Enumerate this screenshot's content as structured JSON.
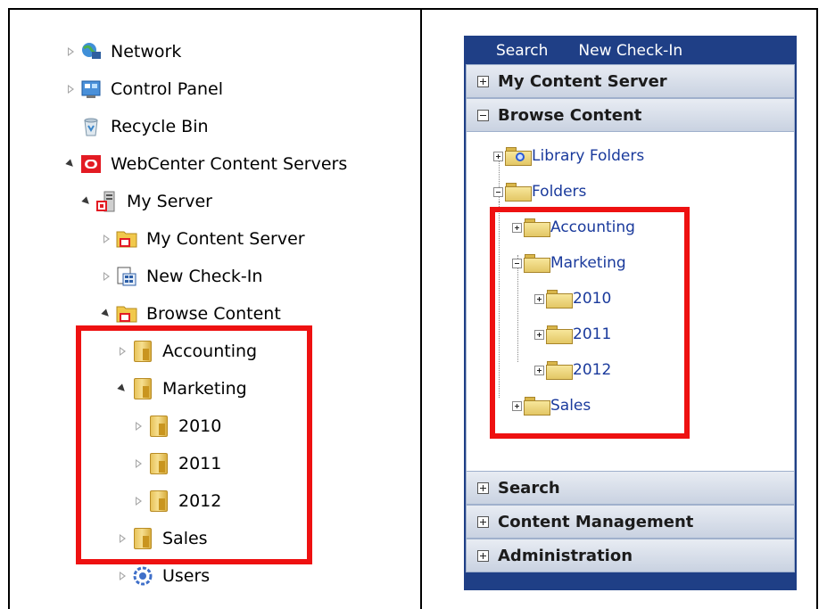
{
  "explorer": {
    "items": [
      {
        "label": "Network",
        "icon": "network-icon"
      },
      {
        "label": "Control Panel",
        "icon": "control-panel-icon"
      },
      {
        "label": "Recycle Bin",
        "icon": "recycle-bin-icon"
      },
      {
        "label": "WebCenter Content Servers",
        "icon": "oracle-icon"
      },
      {
        "label": "My Server",
        "icon": "server-icon"
      },
      {
        "label": "My Content Server",
        "icon": "folder-icon"
      },
      {
        "label": "New Check-In",
        "icon": "checkin-icon"
      },
      {
        "label": "Browse Content",
        "icon": "folder-icon"
      },
      {
        "label": "Accounting",
        "icon": "folder-icon"
      },
      {
        "label": "Marketing",
        "icon": "folder-icon"
      },
      {
        "label": "2010",
        "icon": "folder-icon"
      },
      {
        "label": "2011",
        "icon": "folder-icon"
      },
      {
        "label": "2012",
        "icon": "folder-icon"
      },
      {
        "label": "Sales",
        "icon": "folder-icon"
      },
      {
        "label": "Users",
        "icon": "users-icon"
      }
    ]
  },
  "webcenter": {
    "tabs": [
      "Search",
      "New Check-In"
    ],
    "sections": {
      "my_content_server": "My Content Server",
      "browse_content": "Browse Content",
      "search": "Search",
      "content_management": "Content Management",
      "administration": "Administration"
    },
    "tree": [
      {
        "label": "Library Folders"
      },
      {
        "label": "Folders"
      },
      {
        "label": "Accounting"
      },
      {
        "label": "Marketing"
      },
      {
        "label": "2010"
      },
      {
        "label": "2011"
      },
      {
        "label": "2012"
      },
      {
        "label": "Sales"
      }
    ]
  },
  "colors": {
    "highlight": "#ee1111",
    "panel_bg": "#1f3f86",
    "link": "#1a3a9c"
  }
}
